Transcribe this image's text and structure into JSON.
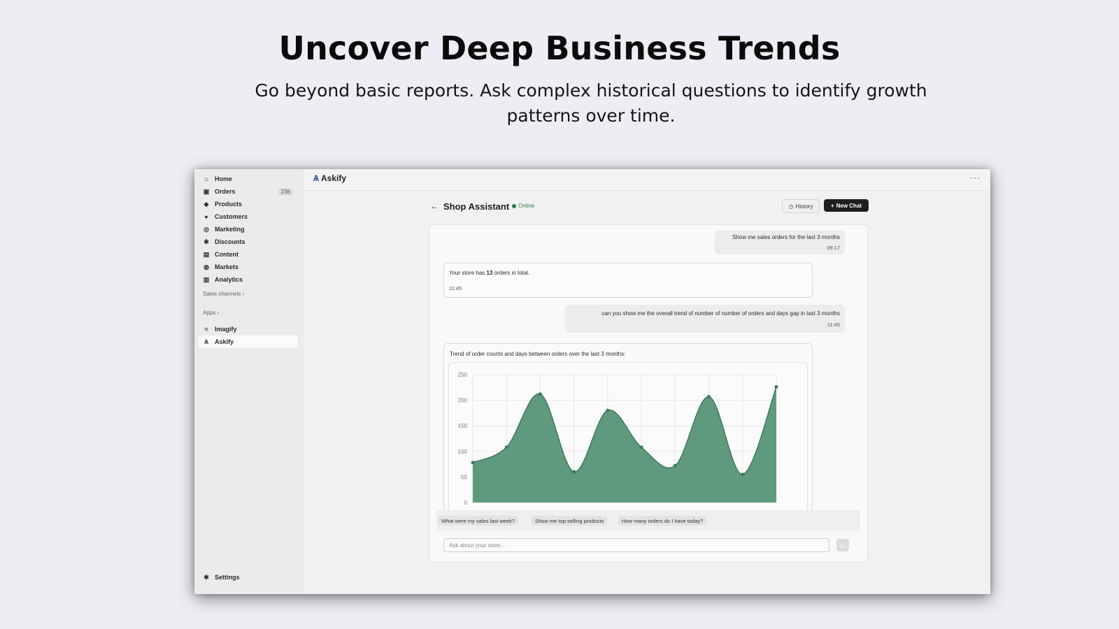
{
  "hero": {
    "title": "Uncover Deep Business Trends",
    "subtitle": "Go beyond basic reports. Ask complex historical questions to identify growth patterns over time."
  },
  "sidebar": {
    "items": [
      {
        "label": "Home",
        "icon": "home-icon",
        "glyph": "⌂"
      },
      {
        "label": "Orders",
        "icon": "orders-icon",
        "glyph": "▣",
        "badge": "236"
      },
      {
        "label": "Products",
        "icon": "tag-icon",
        "glyph": "◆"
      },
      {
        "label": "Customers",
        "icon": "person-icon",
        "glyph": "●"
      },
      {
        "label": "Marketing",
        "icon": "target-icon",
        "glyph": "◎"
      },
      {
        "label": "Discounts",
        "icon": "discount-icon",
        "glyph": "✱"
      },
      {
        "label": "Content",
        "icon": "content-icon",
        "glyph": "▤"
      },
      {
        "label": "Markets",
        "icon": "globe-icon",
        "glyph": "◍"
      },
      {
        "label": "Analytics",
        "icon": "bar-chart-icon",
        "glyph": "▥"
      }
    ],
    "sales_channels": "Sales channels",
    "apps_label": "Apps",
    "apps": [
      {
        "label": "Imagify",
        "icon": "imagify-icon",
        "glyph": "≈"
      },
      {
        "label": "Askify",
        "icon": "askify-icon",
        "glyph": "Ѧ"
      }
    ],
    "settings": "Settings"
  },
  "topbar": {
    "brand": "Askify",
    "more": "···"
  },
  "chat": {
    "back": "←",
    "title": "Shop Assistant",
    "status": "Online",
    "history_label": "History",
    "new_chat_label": "New Chat",
    "messages": [
      {
        "role": "user",
        "text": "Show me sales orders for the last 3 months",
        "time": "09:17"
      },
      {
        "role": "bot",
        "text_prefix": "Your store has ",
        "text_bold": "13",
        "text_suffix": " orders in total.",
        "time": "11:45"
      },
      {
        "role": "user",
        "text": "can you show me the overall trend of number of number of orders and days gap in last 3 months",
        "time": "11:45"
      }
    ],
    "chart_caption": "Trend of order counts and days between orders over the last 3 months:",
    "suggestions": [
      "What were my sales last week?",
      "Show me top-selling products",
      "How many orders do I have today?"
    ],
    "input_placeholder": "Ask about your store...",
    "send_glyph": "▷"
  },
  "colors": {
    "accent": "#2e7d4f",
    "area_fill": "#5f9a7e",
    "area_stroke": "#3f7a5e"
  },
  "chart_data": {
    "type": "area",
    "yticks": [
      0,
      50,
      100,
      150,
      200,
      250
    ],
    "ylim": [
      0,
      250
    ],
    "x_count": 10,
    "points": [
      78,
      108,
      212,
      60,
      180,
      108,
      72,
      207,
      55,
      226
    ],
    "grid": true
  }
}
